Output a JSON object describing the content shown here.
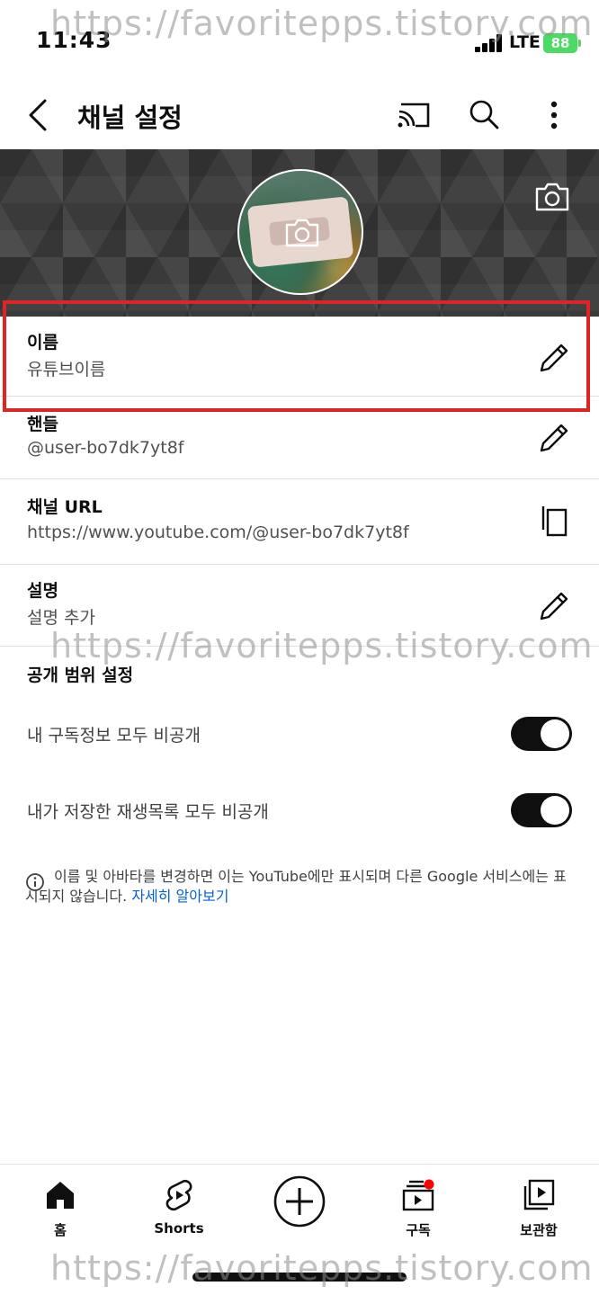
{
  "status_bar": {
    "time": "11:43",
    "network": "LTE",
    "battery": "88"
  },
  "header": {
    "title": "채널 설정",
    "icons": [
      "back-arrow-icon",
      "cast-icon",
      "search-icon",
      "more-vert-icon"
    ]
  },
  "channel_fields": [
    {
      "label": "이름",
      "value": "유튜브이름",
      "action_icon": "pencil-icon"
    },
    {
      "label": "핸들",
      "value": "@user-bo7dk7yt8f",
      "action_icon": "pencil-icon"
    },
    {
      "label": "채널 URL",
      "value": "https://www.youtube.com/@user-bo7dk7yt8f",
      "action_icon": "copy-icon"
    },
    {
      "label": "설명",
      "value": "설명 추가",
      "action_icon": "pencil-icon"
    }
  ],
  "privacy": {
    "section_title": "공개 범위 설정",
    "toggles": [
      {
        "label": "내 구독정보 모두 비공개",
        "on": true
      },
      {
        "label": "내가 저장한 재생목록 모두 비공개",
        "on": true
      }
    ]
  },
  "info_note": {
    "text": "이름 및 아바타를 변경하면 이는 YouTube에만 표시되며 다른 Google 서비스에는 표시되지 않습니다.",
    "link": "자세히 알아보기"
  },
  "bottom_nav": {
    "items": [
      {
        "label": "홈",
        "icon": "home-icon"
      },
      {
        "label": "Shorts",
        "icon": "shorts-icon"
      },
      {
        "label": "",
        "icon": "create-plus-icon"
      },
      {
        "label": "구독",
        "icon": "subscriptions-icon"
      },
      {
        "label": "보관함",
        "icon": "library-icon"
      }
    ]
  },
  "watermark": "https://favoritepps.tistory.com",
  "colors": {
    "highlight": "#e02424",
    "link": "#065fd4",
    "battery": "#4cd964",
    "notification_dot": "#ff0000"
  }
}
